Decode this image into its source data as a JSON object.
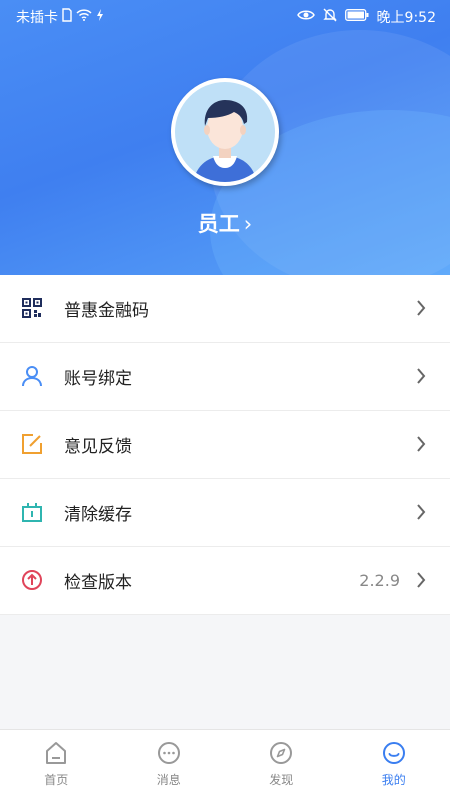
{
  "status_bar": {
    "carrier": "未插卡",
    "time": "晚上9:52"
  },
  "profile": {
    "name": "员工",
    "chevron": "›"
  },
  "menu": [
    {
      "label": "普惠金融码",
      "icon": "qr-code-icon",
      "value": ""
    },
    {
      "label": "账号绑定",
      "icon": "user-icon",
      "value": ""
    },
    {
      "label": "意见反馈",
      "icon": "feedback-edit-icon",
      "value": ""
    },
    {
      "label": "清除缓存",
      "icon": "clear-cache-icon",
      "value": ""
    },
    {
      "label": "检查版本",
      "icon": "upgrade-icon",
      "value": "2.2.9"
    }
  ],
  "tabs": [
    {
      "label": "首页",
      "icon": "home-icon",
      "active": false
    },
    {
      "label": "消息",
      "icon": "message-icon",
      "active": false
    },
    {
      "label": "发现",
      "icon": "compass-icon",
      "active": false
    },
    {
      "label": "我的",
      "icon": "smile-icon",
      "active": true
    }
  ],
  "colors": {
    "accent": "#3a7ef0",
    "header_blue": "#4a8ef5",
    "qr": "#1f2d5c",
    "user": "#4a8ef5",
    "feedback": "#f0a030",
    "cache": "#2fb5b0",
    "upgrade": "#e0445a"
  }
}
